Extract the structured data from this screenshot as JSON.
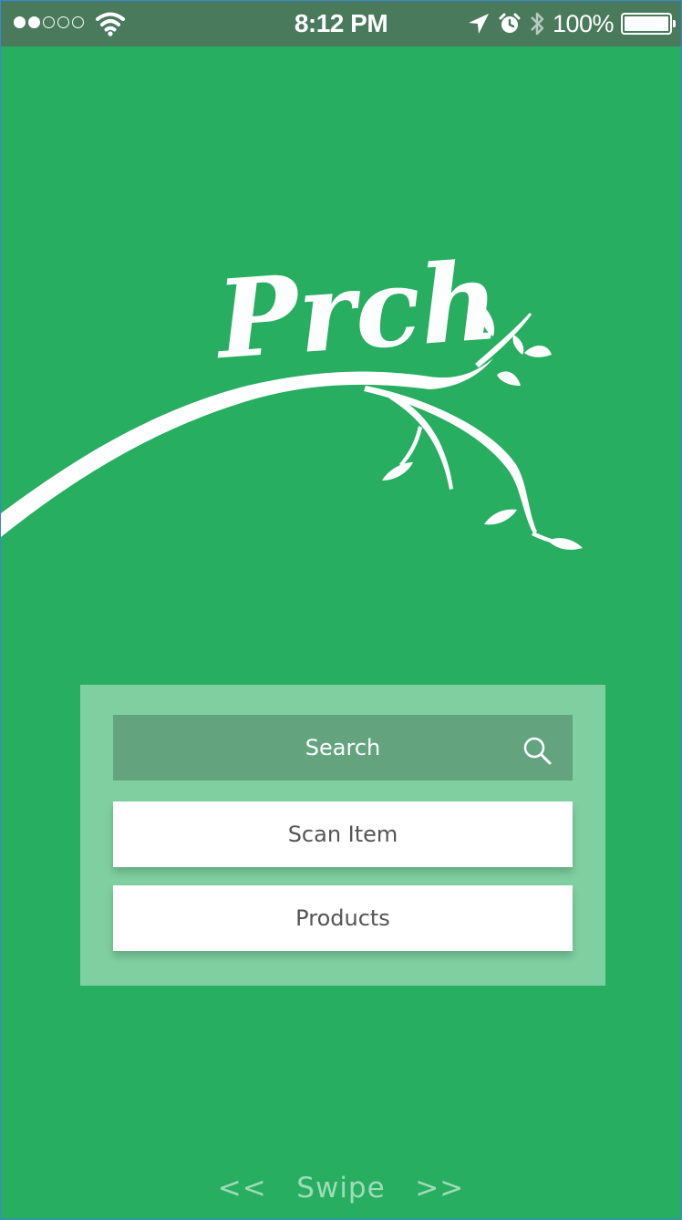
{
  "status_bar": {
    "signal_bars_filled": 2,
    "signal_bars_total": 5,
    "time": "8:12 PM",
    "battery_percent": "100%",
    "icons": [
      "wifi-icon",
      "location-arrow-icon",
      "alarm-icon",
      "bluetooth-icon",
      "battery-icon"
    ]
  },
  "logo": {
    "text": "Prch"
  },
  "menu": {
    "search_label": "Search",
    "scan_label": "Scan Item",
    "products_label": "Products"
  },
  "swipe_hint": "<<   Swipe   >>",
  "colors": {
    "background": "#27ae60",
    "status_bar": "#4a7a5c",
    "panel": "#7fcfa1",
    "search_bar": "#63a47f",
    "button": "#ffffff",
    "button_text": "#555555",
    "swipe_text": "#9fdbb8"
  }
}
